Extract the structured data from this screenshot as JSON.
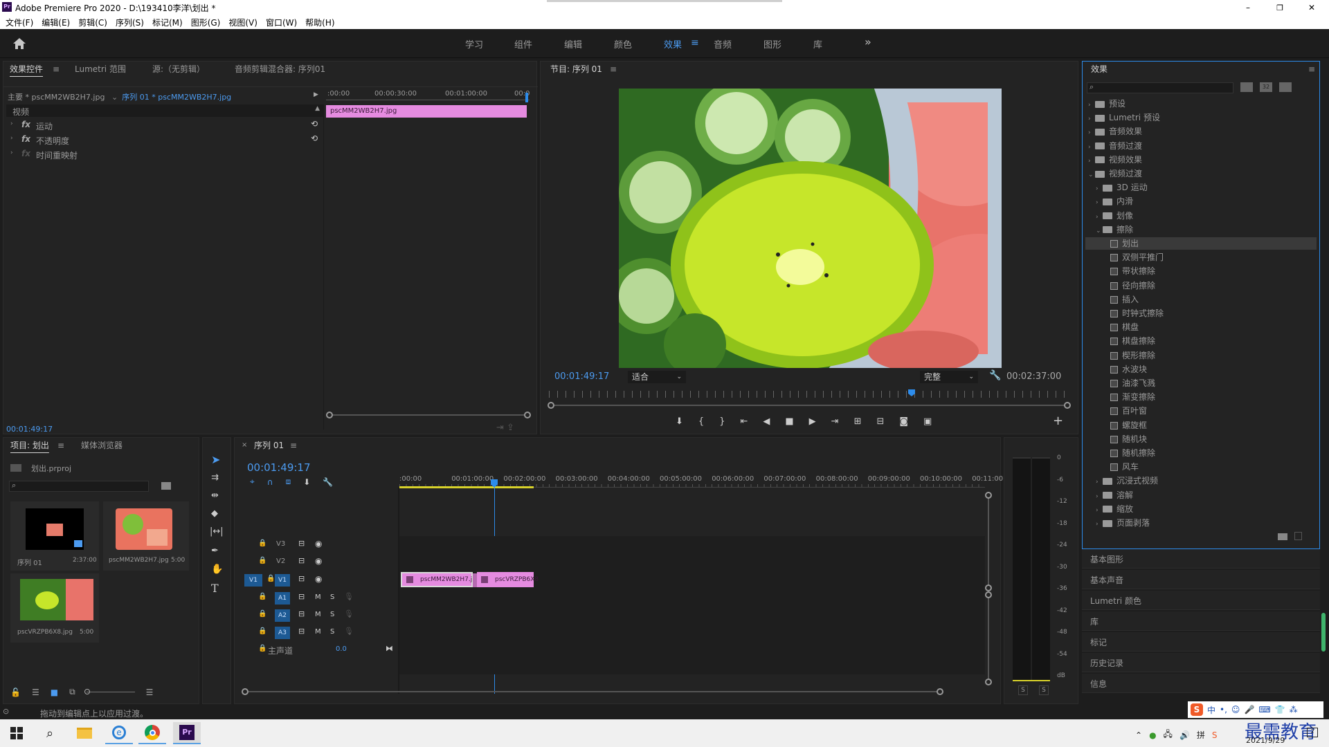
{
  "window": {
    "title": "Adobe Premiere Pro 2020 - D:\\193410李洋\\划出 *",
    "app_icon_text": "Pr",
    "min": "–",
    "max": "❐",
    "close": "✕"
  },
  "menu": [
    "文件(F)",
    "编辑(E)",
    "剪辑(C)",
    "序列(S)",
    "标记(M)",
    "图形(G)",
    "视图(V)",
    "窗口(W)",
    "帮助(H)"
  ],
  "workspaces": {
    "items": [
      "学习",
      "组件",
      "编辑",
      "颜色",
      "效果",
      "音频",
      "图形",
      "库"
    ],
    "active": "效果",
    "more": "»"
  },
  "effect_controls": {
    "tabs": [
      "效果控件",
      "Lumetri 范围",
      "源:（无剪辑）",
      "音频剪辑混合器: 序列01"
    ],
    "master_label": "主要 * pscMM2WB2H7.jpg",
    "sequence_label": "序列 01 * pscMM2WB2H7.jpg",
    "ruler": [
      ":00:00",
      "00:00:30:00",
      "00:01:00:00",
      "00:0"
    ],
    "clip_name": "pscMM2WB2H7.jpg",
    "section": "视频",
    "effects": [
      "运动",
      "不透明度",
      "时间重映射"
    ],
    "timecode": "00:01:49:17"
  },
  "program": {
    "title": "节目: 序列 01",
    "timecode": "00:01:49:17",
    "fit": "适合",
    "quality": "完整",
    "duration": "00:02:37:00"
  },
  "effects_panel": {
    "title": "效果",
    "tree": [
      {
        "label": "预设",
        "level": 0,
        "type": "folder",
        "open": false
      },
      {
        "label": "Lumetri 预设",
        "level": 0,
        "type": "folder",
        "open": false
      },
      {
        "label": "音频效果",
        "level": 0,
        "type": "folder",
        "open": false
      },
      {
        "label": "音频过渡",
        "level": 0,
        "type": "folder",
        "open": false
      },
      {
        "label": "视频效果",
        "level": 0,
        "type": "folder",
        "open": false
      },
      {
        "label": "视频过渡",
        "level": 0,
        "type": "folder",
        "open": true
      },
      {
        "label": "3D 运动",
        "level": 1,
        "type": "folder",
        "open": false
      },
      {
        "label": "内滑",
        "level": 1,
        "type": "folder",
        "open": false
      },
      {
        "label": "划像",
        "level": 1,
        "type": "folder",
        "open": false
      },
      {
        "label": "擦除",
        "level": 1,
        "type": "folder",
        "open": true
      },
      {
        "label": "划出",
        "level": 2,
        "type": "fx",
        "selected": true
      },
      {
        "label": "双侧平推门",
        "level": 2,
        "type": "fx"
      },
      {
        "label": "带状擦除",
        "level": 2,
        "type": "fx"
      },
      {
        "label": "径向擦除",
        "level": 2,
        "type": "fx"
      },
      {
        "label": "插入",
        "level": 2,
        "type": "fx"
      },
      {
        "label": "时钟式擦除",
        "level": 2,
        "type": "fx"
      },
      {
        "label": "棋盘",
        "level": 2,
        "type": "fx"
      },
      {
        "label": "棋盘擦除",
        "level": 2,
        "type": "fx"
      },
      {
        "label": "楔形擦除",
        "level": 2,
        "type": "fx"
      },
      {
        "label": "水波块",
        "level": 2,
        "type": "fx"
      },
      {
        "label": "油漆飞溅",
        "level": 2,
        "type": "fx"
      },
      {
        "label": "渐变擦除",
        "level": 2,
        "type": "fx"
      },
      {
        "label": "百叶窗",
        "level": 2,
        "type": "fx"
      },
      {
        "label": "螺旋框",
        "level": 2,
        "type": "fx"
      },
      {
        "label": "随机块",
        "level": 2,
        "type": "fx"
      },
      {
        "label": "随机擦除",
        "level": 2,
        "type": "fx"
      },
      {
        "label": "风车",
        "level": 2,
        "type": "fx"
      },
      {
        "label": "沉浸式视频",
        "level": 1,
        "type": "folder",
        "open": false
      },
      {
        "label": "溶解",
        "level": 1,
        "type": "folder",
        "open": false
      },
      {
        "label": "缩放",
        "level": 1,
        "type": "folder",
        "open": false
      },
      {
        "label": "页面剥落",
        "level": 1,
        "type": "folder",
        "open": false
      }
    ],
    "side_panels": [
      "基本图形",
      "基本声音",
      "Lumetri 颜色",
      "库",
      "标记",
      "历史记录",
      "信息"
    ]
  },
  "project": {
    "tabs": [
      "项目: 划出",
      "媒体浏览器"
    ],
    "file": "划出.prproj",
    "items": [
      {
        "name": "序列 01",
        "dur": "2:37:00"
      },
      {
        "name": "pscMM2WB2H7.jpg",
        "dur": "5:00"
      },
      {
        "name": "pscVRZPB6X8.jpg",
        "dur": "5:00"
      }
    ]
  },
  "timeline": {
    "tab": "序列 01",
    "timecode": "00:01:49:17",
    "ruler": [
      ":00:00",
      "00:01:00:00",
      "00:02:00:00",
      "00:03:00:00",
      "00:04:00:00",
      "00:05:00:00",
      "00:06:00:00",
      "00:07:00:00",
      "00:08:00:00",
      "00:09:00:00",
      "00:10:00:00",
      "00:11:00:"
    ],
    "video_tracks": [
      "V3",
      "V2",
      "V1"
    ],
    "audio_tracks": [
      "A1",
      "A2",
      "A3"
    ],
    "source_patch": "V1",
    "master": "主声道",
    "master_val": "0.0",
    "clips": [
      "pscMM2WB2H7.j",
      "pscVRZPB6X8"
    ],
    "m": "M",
    "s": "S"
  },
  "meter": {
    "scale": [
      "0",
      "-6",
      "-12",
      "-18",
      "-24",
      "-30",
      "-36",
      "-42",
      "-48",
      "-54",
      "dB"
    ],
    "buttons": [
      "S",
      "S"
    ]
  },
  "status": {
    "text": "拖动到编辑点上以应用过渡。"
  },
  "taskbar": {
    "watermark": "最需教育",
    "date": "2021/9/29",
    "ime": "中"
  }
}
